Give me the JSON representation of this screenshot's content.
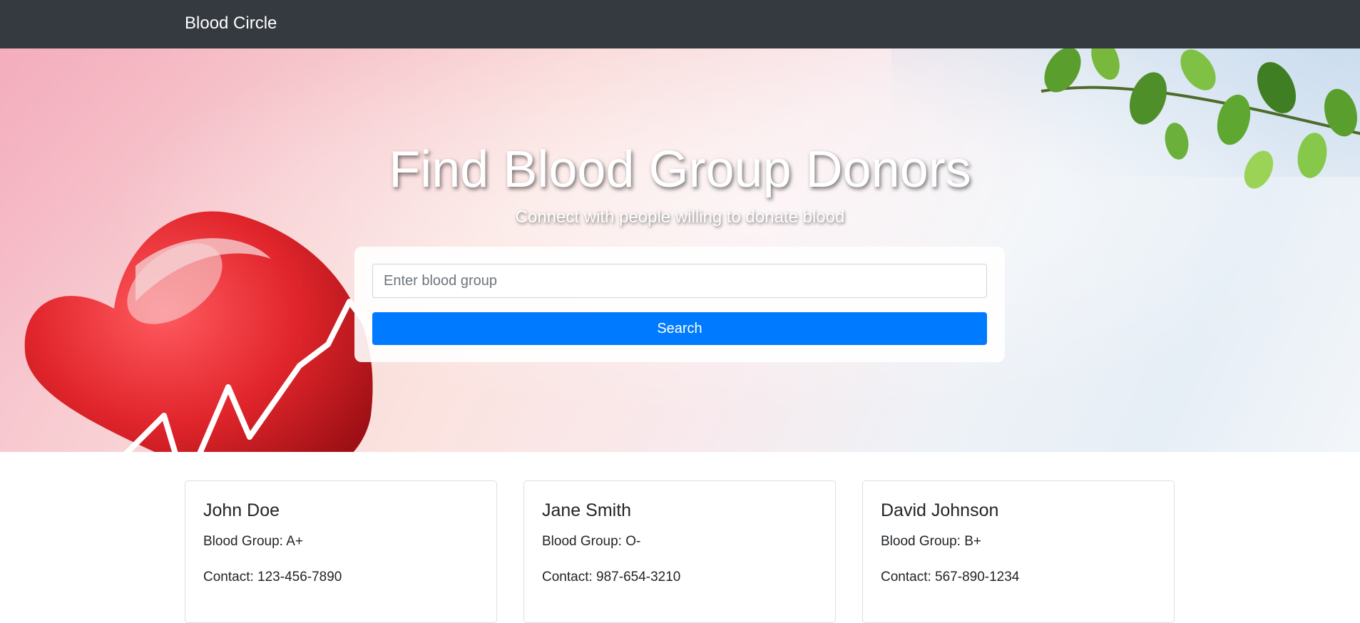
{
  "navbar": {
    "brand": "Blood Circle"
  },
  "hero": {
    "title": "Find Blood Group Donors",
    "subtitle": "Connect with people willing to donate blood"
  },
  "search": {
    "placeholder": "Enter blood group",
    "value": "",
    "button_label": "Search"
  },
  "donors": [
    {
      "name": "John Doe",
      "blood_group": "Blood Group: A+",
      "contact": "Contact: 123-456-7890"
    },
    {
      "name": "Jane Smith",
      "blood_group": "Blood Group: O-",
      "contact": "Contact: 987-654-3210"
    },
    {
      "name": "David Johnson",
      "blood_group": "Blood Group: B+",
      "contact": "Contact: 567-890-1234"
    }
  ],
  "colors": {
    "navbar_bg": "#343a40",
    "primary": "#007bff",
    "heart_red": "#e0252b"
  },
  "icons": [
    "heart-illustration",
    "leaves-illustration"
  ]
}
